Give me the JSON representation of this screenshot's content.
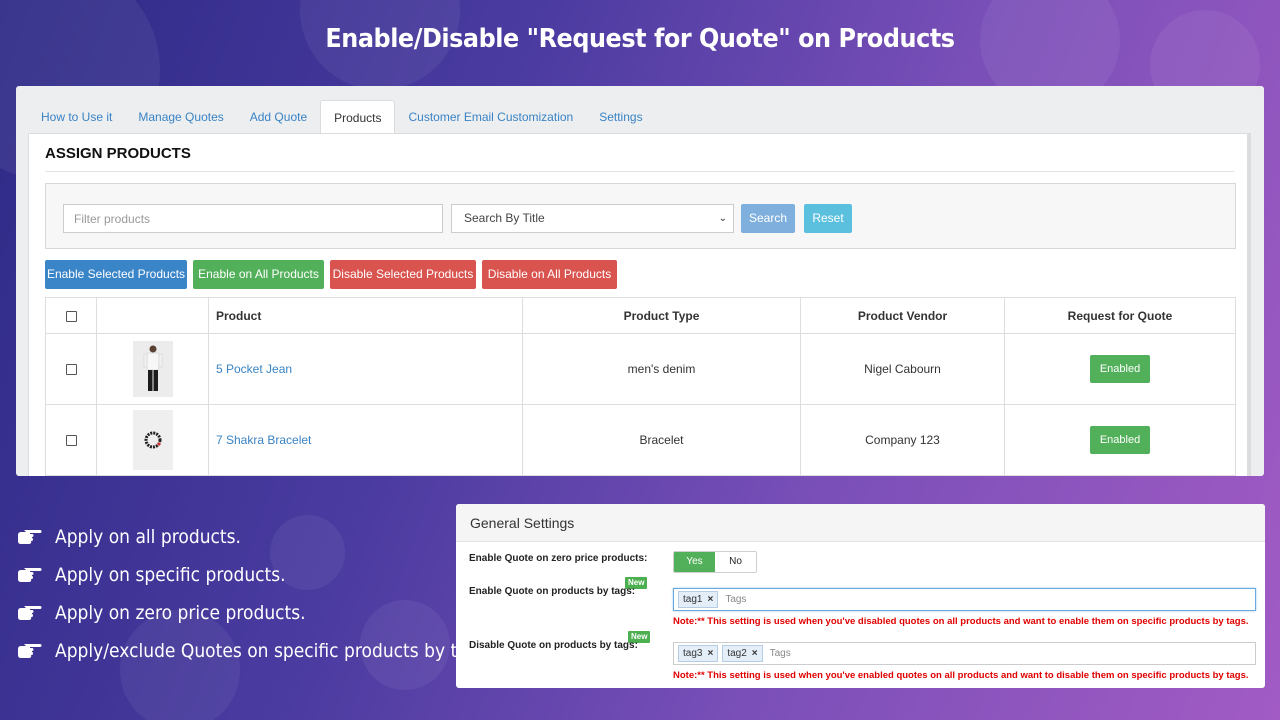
{
  "headline": "Enable/Disable \"Request for Quote\" on Products",
  "tabs": [
    "How to Use it",
    "Manage Quotes",
    "Add Quote",
    "Products",
    "Customer Email Customization",
    "Settings"
  ],
  "section_title": "ASSIGN PRODUCTS",
  "filter": {
    "placeholder": "Filter products",
    "select_value": "Search By Title",
    "search_label": "Search",
    "reset_label": "Reset"
  },
  "actions": {
    "enable_selected": "Enable Selected Products",
    "enable_all": "Enable on All Products",
    "disable_selected": "Disable Selected Products",
    "disable_all": "Disable on All Products"
  },
  "table": {
    "headers": {
      "product": "Product",
      "type": "Product Type",
      "vendor": "Product Vendor",
      "rfq": "Request for Quote"
    },
    "rows": [
      {
        "name": "5 Pocket Jean",
        "type": "men's denim",
        "vendor": "Nigel Cabourn",
        "status": "Enabled"
      },
      {
        "name": "7 Shakra Bracelet",
        "type": "Bracelet",
        "vendor": "Company 123",
        "status": "Enabled"
      }
    ]
  },
  "bullets": [
    "Apply on all products.",
    "Apply on specific products.",
    "Apply on zero price products.",
    "Apply/exclude Quotes on specific products by tags."
  ],
  "settings": {
    "header": "General Settings",
    "zero_price_label": "Enable Quote on zero price products:",
    "yes_label": "Yes",
    "no_label": "No",
    "enable_tags_label": "Enable Quote on products by tags:",
    "disable_tags_label": "Disable Quote on products by tags:",
    "new_badge": "New",
    "enable_tags": [
      "tag1"
    ],
    "enable_tags_placeholder": "Tags",
    "disable_tags": [
      "tag3",
      "tag2"
    ],
    "disable_tags_placeholder": "Tags",
    "enable_note": "Note:** This setting is used when you've disabled quotes on all products and want to enable them on specific products by tags.",
    "disable_note": "Note:** This setting is used when you've enabled quotes on all products and want to disable them on specific products by tags."
  },
  "colors": {
    "accent_blue": "#3a84c8",
    "enabled_green": "#52b05a",
    "danger_red": "#d9534f",
    "link_blue": "#3a83c4"
  }
}
